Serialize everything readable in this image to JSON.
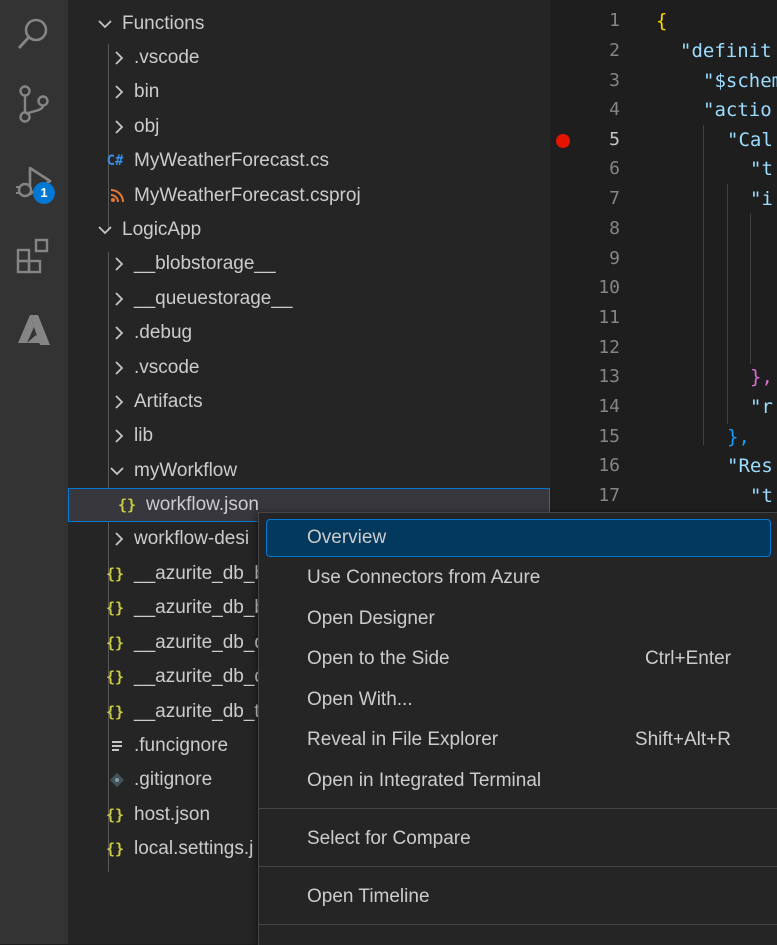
{
  "activity_bar": {
    "items": [
      {
        "icon": "search-icon"
      },
      {
        "icon": "source-control-icon"
      },
      {
        "icon": "run-debug-icon",
        "badge": "1"
      },
      {
        "icon": "extensions-icon"
      },
      {
        "icon": "azure-icon"
      }
    ],
    "accent_color": "#0078d4"
  },
  "explorer": {
    "items": [
      {
        "label": "Functions",
        "kind": "folder-open"
      },
      {
        "label": ".vscode",
        "kind": "folder"
      },
      {
        "label": "bin",
        "kind": "folder"
      },
      {
        "label": "obj",
        "kind": "folder"
      },
      {
        "label": "MyWeatherForecast.cs",
        "kind": "csharp-file"
      },
      {
        "label": "MyWeatherForecast.csproj",
        "kind": "rss-file"
      },
      {
        "label": "LogicApp",
        "kind": "folder-open"
      },
      {
        "label": "__blobstorage__",
        "kind": "folder"
      },
      {
        "label": "__queuestorage__",
        "kind": "folder"
      },
      {
        "label": ".debug",
        "kind": "folder"
      },
      {
        "label": ".vscode",
        "kind": "folder"
      },
      {
        "label": "Artifacts",
        "kind": "folder"
      },
      {
        "label": "lib",
        "kind": "folder"
      },
      {
        "label": "myWorkflow",
        "kind": "folder-open"
      },
      {
        "label": "workflow.json",
        "kind": "json-file",
        "selected": true
      },
      {
        "label": "workflow-desi",
        "kind": "folder"
      },
      {
        "label": "__azurite_db_b",
        "kind": "json-file"
      },
      {
        "label": "__azurite_db_b",
        "kind": "json-file"
      },
      {
        "label": "__azurite_db_q",
        "kind": "json-file"
      },
      {
        "label": "__azurite_db_q",
        "kind": "json-file"
      },
      {
        "label": "__azurite_db_t",
        "kind": "json-file"
      },
      {
        "label": ".funcignore",
        "kind": "text-file"
      },
      {
        "label": ".gitignore",
        "kind": "git-file"
      },
      {
        "label": "host.json",
        "kind": "json-file"
      },
      {
        "label": "local.settings.j",
        "kind": "json-file"
      }
    ]
  },
  "editor": {
    "line_numbers": [
      "1",
      "2",
      "3",
      "4",
      "5",
      "6",
      "7",
      "8",
      "9",
      "10",
      "11",
      "12",
      "13",
      "14",
      "15",
      "16",
      "17"
    ],
    "lines": [
      "{",
      "\"definit",
      "\"$schem",
      "\"actio",
      "\"Cal",
      "\"t",
      "\"i",
      "",
      "",
      "",
      "",
      "",
      "},",
      "\"r",
      "},",
      "\"Res",
      "\"t"
    ],
    "breakpoint_line": "5"
  },
  "context_menu": {
    "items": [
      {
        "label": "Overview",
        "shortcut": "",
        "active": true
      },
      {
        "label": "Use Connectors from Azure",
        "shortcut": ""
      },
      {
        "label": "Open Designer",
        "shortcut": ""
      },
      {
        "label": "Open to the Side",
        "shortcut": "Ctrl+Enter"
      },
      {
        "label": "Open With...",
        "shortcut": ""
      },
      {
        "label": "Reveal in File Explorer",
        "shortcut": "Shift+Alt+R"
      },
      {
        "label": "Open in Integrated Terminal",
        "shortcut": ""
      },
      {
        "label": "Select for Compare",
        "shortcut": ""
      },
      {
        "label": "Open Timeline",
        "shortcut": ""
      }
    ]
  },
  "colors": {
    "json_icon": "#cbcb41",
    "csharp_icon": "#3a8ee6",
    "rss_icon": "#e37933",
    "punct_bracket": "#ffd700",
    "punct_bracket2": "#da70d6",
    "punct_bracket3": "#179fff",
    "string_key": "#9cdcfe",
    "breakpoint": "#e51400"
  }
}
